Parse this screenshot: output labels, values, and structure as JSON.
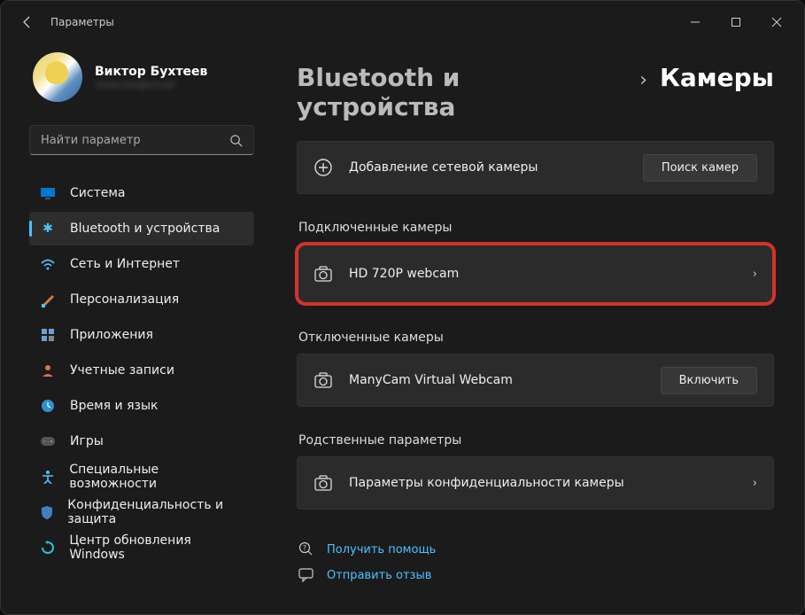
{
  "titlebar": {
    "title": "Параметры"
  },
  "profile": {
    "name": "Виктор Бухтеев",
    "email": "redacted@email"
  },
  "search": {
    "placeholder": "Найти параметр"
  },
  "nav": {
    "system": "Система",
    "bluetooth": "Bluetooth и устройства",
    "network": "Сеть и Интернет",
    "personalization": "Персонализация",
    "apps": "Приложения",
    "accounts": "Учетные записи",
    "time": "Время и язык",
    "gaming": "Игры",
    "accessibility": "Специальные возможности",
    "privacy": "Конфиденциальность и защита",
    "update": "Центр обновления Windows"
  },
  "breadcrumb": {
    "parent": "Bluetooth и устройства",
    "sep": "›",
    "current": "Камеры"
  },
  "add_camera": {
    "label": "Добавление сетевой камеры",
    "button": "Поиск камер"
  },
  "sections": {
    "connected": "Подключенные камеры",
    "disconnected": "Отключенные камеры",
    "related": "Родственные параметры"
  },
  "connected_camera": {
    "name": "HD 720P webcam"
  },
  "disconnected_camera": {
    "name": "ManyCam Virtual Webcam",
    "button": "Включить"
  },
  "privacy_card": {
    "label": "Параметры конфиденциальности камеры"
  },
  "footer": {
    "help": "Получить помощь",
    "feedback": "Отправить отзыв"
  }
}
